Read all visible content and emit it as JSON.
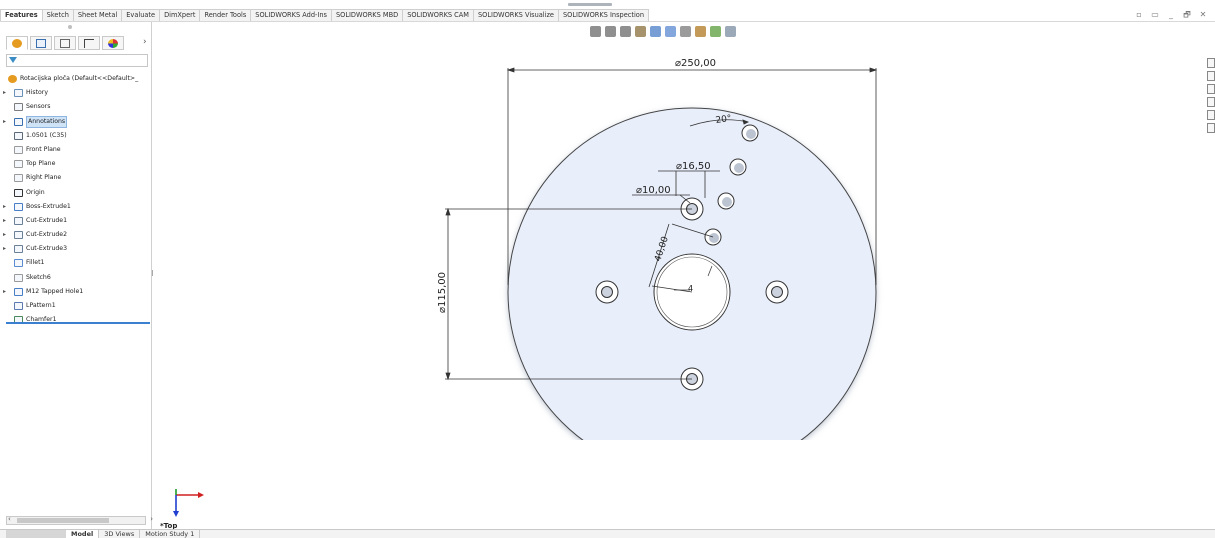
{
  "command_tabs": [
    {
      "label": "Features",
      "active": true
    },
    {
      "label": "Sketch",
      "active": false
    },
    {
      "label": "Sheet Metal",
      "active": false
    },
    {
      "label": "Evaluate",
      "active": false
    },
    {
      "label": "DimXpert",
      "active": false
    },
    {
      "label": "Render Tools",
      "active": false
    },
    {
      "label": "SOLIDWORKS Add-Ins",
      "active": false
    },
    {
      "label": "SOLIDWORKS MBD",
      "active": false
    },
    {
      "label": "SOLIDWORKS CAM",
      "active": false
    },
    {
      "label": "SOLIDWORKS Visualize",
      "active": false
    },
    {
      "label": "SOLIDWORKS Inspection",
      "active": false
    }
  ],
  "window_controls": [
    "restore-icon",
    "tile-icon",
    "minimize-icon",
    "maximize-icon",
    "close-icon"
  ],
  "window_control_glyphs": [
    "▫",
    "▭",
    "_",
    "🗗",
    "✕"
  ],
  "heads_up_icons": [
    "zoom-fit-icon",
    "zoom-area-icon",
    "previous-view-icon",
    "section-view-icon",
    "view-orientation-icon",
    "display-style-icon",
    "hide-show-icon",
    "edit-appearance-icon",
    "apply-scene-icon",
    "view-settings-icon"
  ],
  "feature_tree": {
    "root": "Rotacijska ploča  (Default<<Default>_",
    "items": [
      {
        "label": "History",
        "icon": "history-icon",
        "expandable": true
      },
      {
        "label": "Sensors",
        "icon": "sensors-icon",
        "expandable": false
      },
      {
        "label": "Annotations",
        "icon": "annotations-icon",
        "expandable": true,
        "highlighted": true
      },
      {
        "label": "1.0501 (C35)",
        "icon": "material-icon",
        "expandable": false
      },
      {
        "label": "Front Plane",
        "icon": "plane-icon",
        "expandable": false
      },
      {
        "label": "Top Plane",
        "icon": "plane-icon",
        "expandable": false
      },
      {
        "label": "Right Plane",
        "icon": "plane-icon",
        "expandable": false
      },
      {
        "label": "Origin",
        "icon": "origin-icon",
        "expandable": false
      },
      {
        "label": "Boss-Extrude1",
        "icon": "boss-extrude-icon",
        "expandable": true
      },
      {
        "label": "Cut-Extrude1",
        "icon": "cut-extrude-icon",
        "expandable": true
      },
      {
        "label": "Cut-Extrude2",
        "icon": "cut-extrude-icon",
        "expandable": true
      },
      {
        "label": "Cut-Extrude3",
        "icon": "cut-extrude-icon",
        "expandable": true
      },
      {
        "label": "Fillet1",
        "icon": "fillet-icon",
        "expandable": false
      },
      {
        "label": "Sketch6",
        "icon": "sketch-icon",
        "expandable": false
      },
      {
        "label": "M12 Tapped Hole1",
        "icon": "hole-wizard-icon",
        "expandable": true
      },
      {
        "label": "LPattern1",
        "icon": "linear-pattern-icon",
        "expandable": false
      },
      {
        "label": "Chamfer1",
        "icon": "chamfer-icon",
        "expandable": false
      }
    ]
  },
  "drawing": {
    "dim_outer": "⌀250,00",
    "dim_angle": "20°",
    "dim_hole_large": "⌀16,50",
    "dim_hole_small": "⌀10,00",
    "dim_spacing": "40,00",
    "dim_bolt_circle": "⌀115,00",
    "dim_chamfer": "4",
    "plate_color": "#e9effa"
  },
  "view_label": "*Top",
  "bottom_tabs": [
    {
      "label": "Model",
      "active": true
    },
    {
      "label": "3D Views",
      "active": false
    },
    {
      "label": "Motion Study 1",
      "active": false
    }
  ],
  "colors": {
    "accent": "#3a7fd0",
    "triad_x": "#d02020",
    "triad_y": "#1f9a2a",
    "triad_z": "#1f3fd0"
  }
}
